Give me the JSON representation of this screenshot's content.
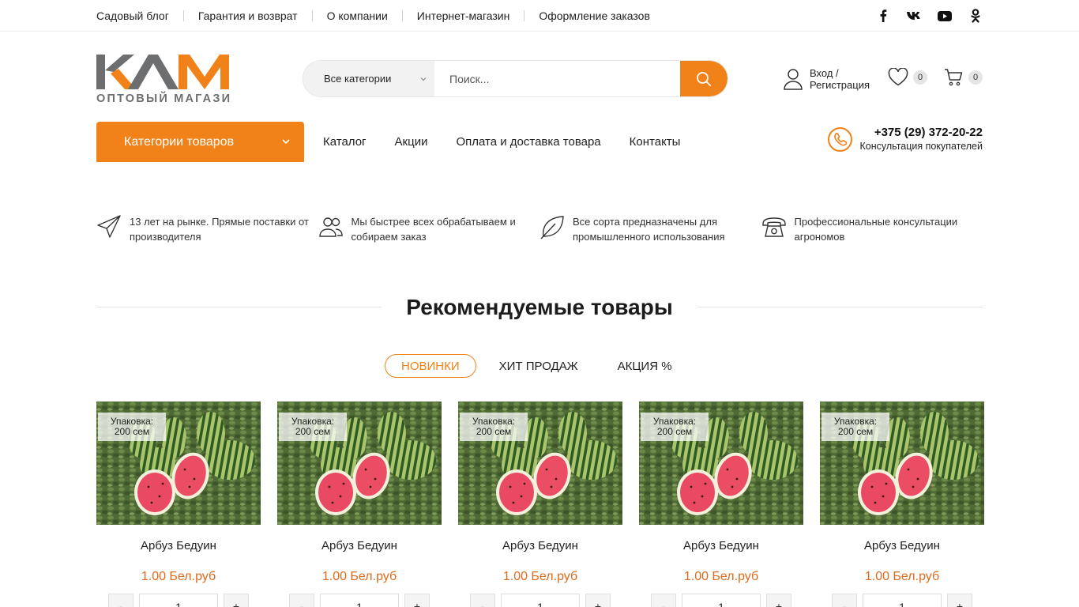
{
  "topbar": {
    "links": [
      "Садовый блог",
      "Гарантия и возврат",
      "О компании",
      "Интернет-магазин",
      "Оформление заказов"
    ],
    "social": [
      "facebook-icon",
      "vk-icon",
      "youtube-icon",
      "odnoklassniki-icon"
    ]
  },
  "logo": {
    "letters": "КАМ",
    "tagline": "ОПТОВЫЙ МАГАЗИН"
  },
  "search": {
    "category_label": "Все категории",
    "placeholder": "Поиск..."
  },
  "account": {
    "line1": "Вход /",
    "line2": "Регистрация"
  },
  "wishlist": {
    "count": "0"
  },
  "cart": {
    "count": "0"
  },
  "nav": {
    "categories_button": "Категории товаров",
    "items": [
      "Каталог",
      "Акции",
      "Оплата и доставка товара",
      "Контакты"
    ]
  },
  "contact": {
    "phone": "+375 (29) 372-20-22",
    "caption": "Консультация покупателей"
  },
  "features": [
    {
      "icon": "paper-plane-icon",
      "text": "13 лет на рынке. Прямые поставки от производителя"
    },
    {
      "icon": "users-icon",
      "text": "Мы быстрее всех обрабатываем и собираем заказ"
    },
    {
      "icon": "leaf-icon",
      "text": "Все сорта предназначены для промышленного использования"
    },
    {
      "icon": "telephone-icon",
      "text": "Профессиональные консультации агрономов"
    }
  ],
  "section": {
    "title": "Рекомендуемые товары",
    "tabs": [
      "НОВИНКИ",
      "ХИТ ПРОДАЖ",
      "АКЦИЯ %"
    ],
    "active_tab": "НОВИНКИ"
  },
  "products": [
    {
      "name": "Арбуз Бедуин",
      "price": "1.00 Бел.руб",
      "pack_label": "Упаковка:",
      "pack_value": "200 сем",
      "qty": "1"
    },
    {
      "name": "Арбуз Бедуин",
      "price": "1.00 Бел.руб",
      "pack_label": "Упаковка:",
      "pack_value": "200 сем",
      "qty": "1"
    },
    {
      "name": "Арбуз Бедуин",
      "price": "1.00 Бел.руб",
      "pack_label": "Упаковка:",
      "pack_value": "200 сем",
      "qty": "1"
    },
    {
      "name": "Арбуз Бедуин",
      "price": "1.00 Бел.руб",
      "pack_label": "Упаковка:",
      "pack_value": "200 сем",
      "qty": "1"
    },
    {
      "name": "Арбуз Бедуин",
      "price": "1.00 Бел.руб",
      "pack_label": "Упаковка:",
      "pack_value": "200 сем",
      "qty": "1"
    }
  ],
  "qty_minus": "-",
  "qty_plus": "+",
  "colors": {
    "accent": "#f08219",
    "price": "#e06a1b",
    "logo_gray": "#6d6e70"
  }
}
